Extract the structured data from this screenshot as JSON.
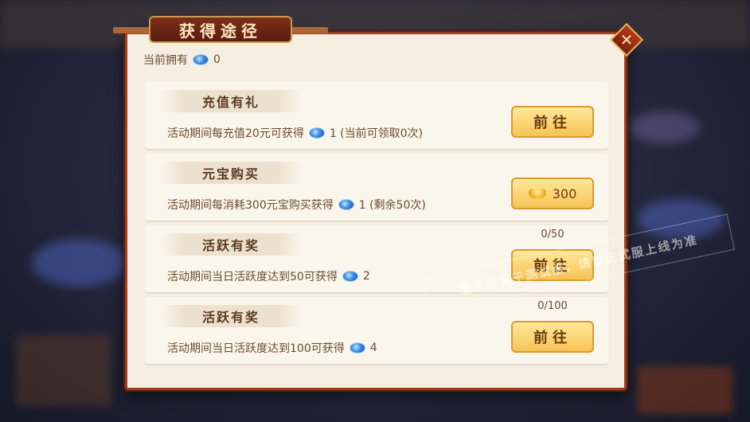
{
  "dialog": {
    "title": "获得途径",
    "close_icon": "close-icon",
    "owned_label": "当前拥有",
    "owned_count": "0"
  },
  "cards": [
    {
      "title": "充值有礼",
      "desc_before": "活动期间每充值20元可获得",
      "desc_after": "1 (当前可领取0次)",
      "button": "前往",
      "progress": ""
    },
    {
      "title": "元宝购买",
      "desc_before": "活动期间每消耗300元宝购买获得",
      "desc_after": "1 (剩余50次)",
      "button_price": "300",
      "progress": ""
    },
    {
      "title": "活跃有奖",
      "desc_before": "活动期间当日活跃度达到50可获得",
      "desc_after": "2",
      "button": "前往",
      "progress": "0/50"
    },
    {
      "title": "活跃有奖",
      "desc_before": "活动期间当日活跃度达到100可获得",
      "desc_after": "4",
      "button": "前往",
      "progress": "0/100"
    }
  ],
  "watermark": "图片来源于测试服，请以正式服上线为准",
  "colors": {
    "dialog_bg": "#f6efe1",
    "frame": "#9e3d1f",
    "button_gold": "#f6c455",
    "text_brown": "#6b4a2e"
  }
}
